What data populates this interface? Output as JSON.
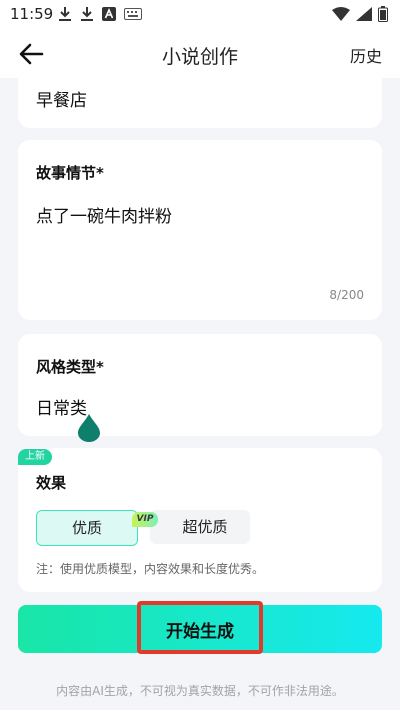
{
  "status": {
    "time": "11:59"
  },
  "appbar": {
    "title": "小说创作",
    "history_label": "历史"
  },
  "name_card": {
    "value": "早餐店"
  },
  "plot_card": {
    "label": "故事情节*",
    "value": "点了一碗牛肉拌粉",
    "counter": "8/200"
  },
  "style_card": {
    "label": "风格类型*",
    "value": "日常类"
  },
  "effect_card": {
    "badge": "上新",
    "label": "效果",
    "options": [
      {
        "label": "优质",
        "selected": true
      },
      {
        "label": "超优质",
        "badge": "VIP"
      }
    ],
    "note": "注：使用优质模型，内容效果和长度优秀。"
  },
  "generate": {
    "label": "开始生成"
  },
  "footer": {
    "disclaimer": "内容由AI生成，不可视为真实数据，不可作非法用途。"
  },
  "colors": {
    "accent": "#19e6a6",
    "accent2": "#16e9ef",
    "highlight": "#e23a2a",
    "drop": "#0e7f6d"
  }
}
